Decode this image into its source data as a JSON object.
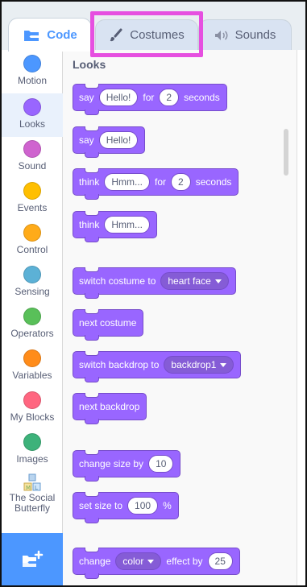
{
  "tabs": {
    "code": "Code",
    "costumes": "Costumes",
    "sounds": "Sounds"
  },
  "categories": [
    {
      "label": "Motion",
      "color": "#4c97ff"
    },
    {
      "label": "Looks",
      "color": "#9966ff",
      "selected": true
    },
    {
      "label": "Sound",
      "color": "#cf63cf"
    },
    {
      "label": "Events",
      "color": "#ffbf00"
    },
    {
      "label": "Control",
      "color": "#ffab19"
    },
    {
      "label": "Sensing",
      "color": "#5cb1d6"
    },
    {
      "label": "Operators",
      "color": "#59c059"
    },
    {
      "label": "Variables",
      "color": "#ff8c1a"
    },
    {
      "label": "My Blocks",
      "color": "#ff6680"
    },
    {
      "label": "Images",
      "color": "#3db27a"
    },
    {
      "label": "The Social Butterfly",
      "color": "#c0d8f0"
    }
  ],
  "palette": {
    "title": "Looks",
    "blocks": {
      "b1": {
        "w1": "say",
        "arg1": "Hello!",
        "w2": "for",
        "arg2": "2",
        "w3": "seconds"
      },
      "b2": {
        "w1": "say",
        "arg1": "Hello!"
      },
      "b3": {
        "w1": "think",
        "arg1": "Hmm...",
        "w2": "for",
        "arg2": "2",
        "w3": "seconds"
      },
      "b4": {
        "w1": "think",
        "arg1": "Hmm..."
      },
      "b5": {
        "w1": "switch costume to",
        "menu": "heart face"
      },
      "b6": {
        "w1": "next costume"
      },
      "b7": {
        "w1": "switch backdrop to",
        "menu": "backdrop1"
      },
      "b8": {
        "w1": "next backdrop"
      },
      "b9": {
        "w1": "change size by",
        "arg1": "10"
      },
      "b10": {
        "w1": "set size to",
        "arg1": "100",
        "w2": "%"
      },
      "b11": {
        "w1": "change",
        "menu": "color",
        "w2": "effect by",
        "arg1": "25"
      }
    }
  },
  "colors": {
    "looks": "#9966ff",
    "highlight": "#e64fe0",
    "code_tab": "#4c97ff"
  }
}
